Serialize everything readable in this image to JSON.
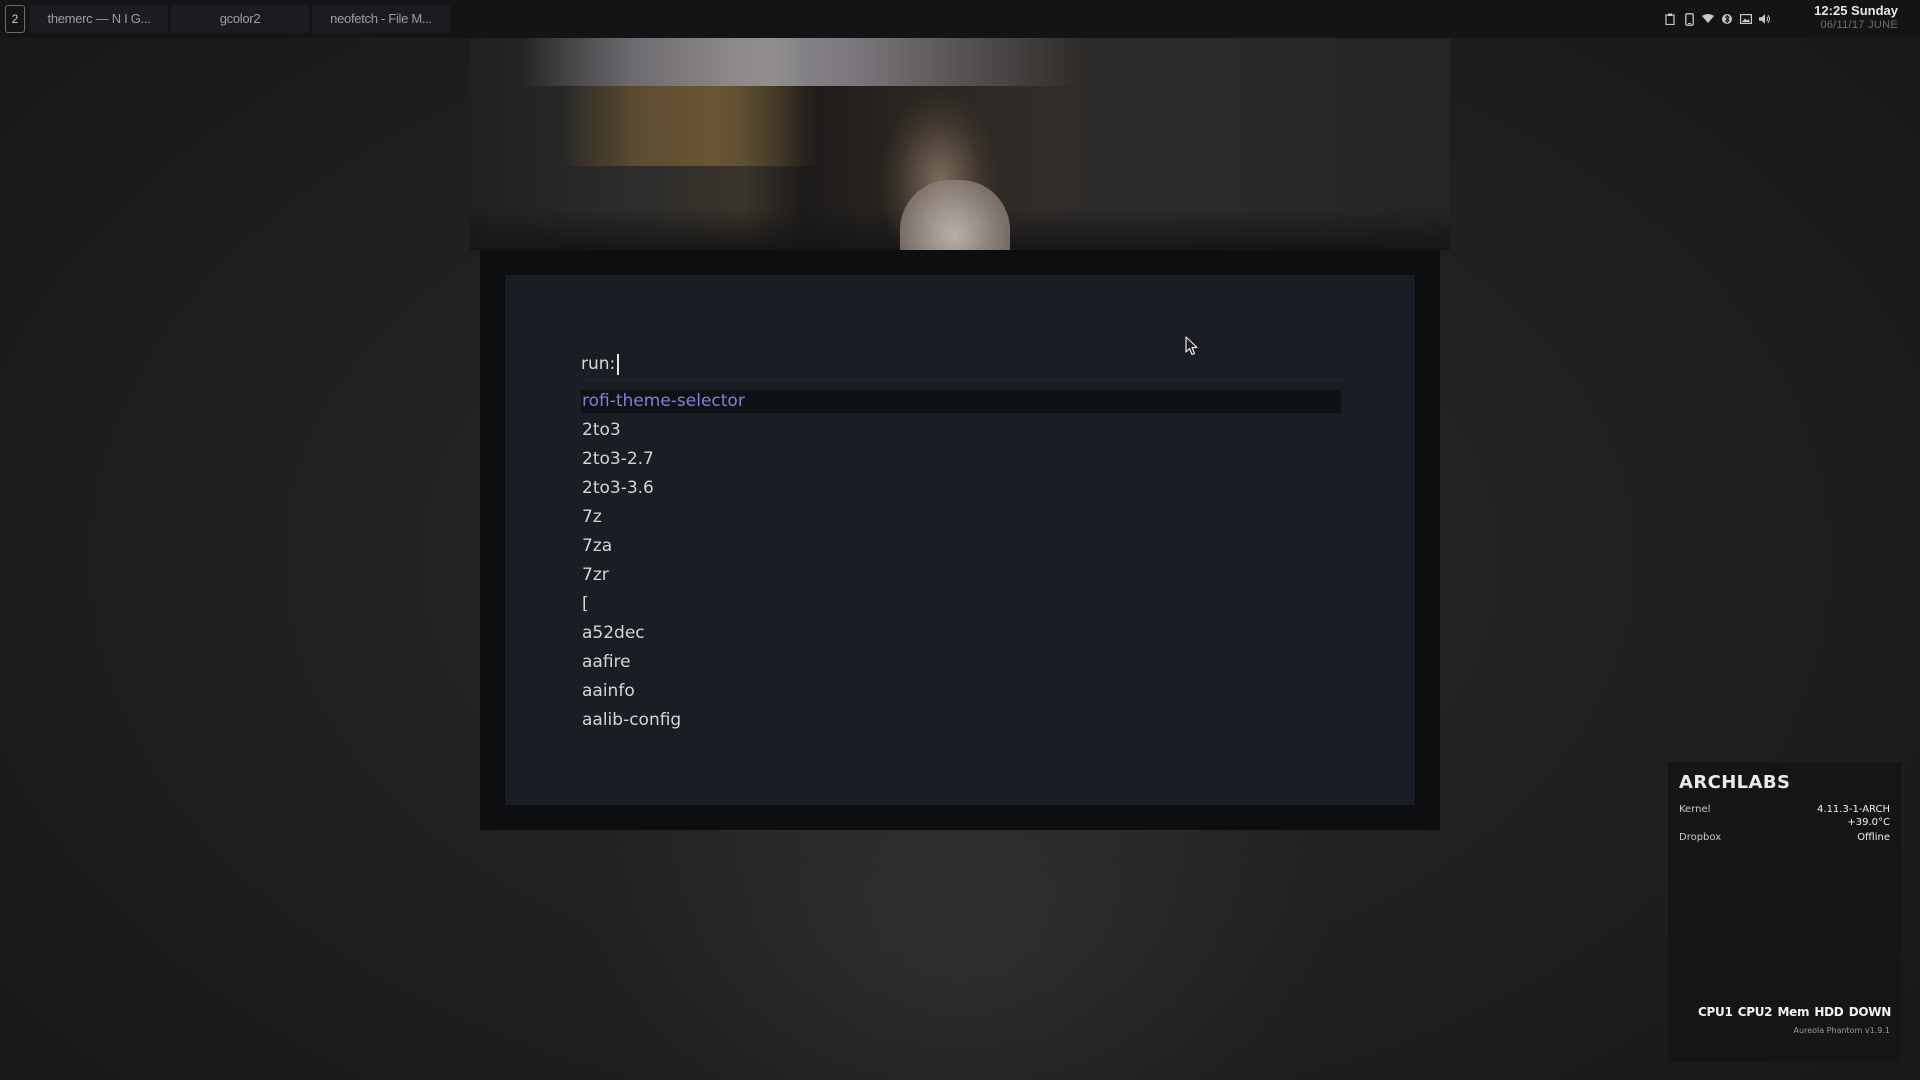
{
  "panel": {
    "workspace": "2",
    "tasks": [
      {
        "label": "themerc — N I G..."
      },
      {
        "label": "gcolor2"
      },
      {
        "label": "neofetch - File M..."
      }
    ],
    "tray_icons": [
      "clipboard-icon",
      "phone-icon",
      "wifi-icon",
      "bluetooth-icon",
      "image-icon",
      "volume-icon"
    ],
    "clock": {
      "time": "12:25 Sunday",
      "date": "06/11/17 JUNE"
    }
  },
  "rofi": {
    "prompt": "run:",
    "input_value": "",
    "results": [
      "rofi-theme-selector",
      "2to3",
      "2to3-2.7",
      "2to3-3.6",
      "7z",
      "7za",
      "7zr",
      "[",
      "a52dec",
      "aafire",
      "aainfo",
      "aalib-config"
    ],
    "selected_index": 0,
    "colors": {
      "selected_text": "#8e7bd8",
      "background": "#1a1e24",
      "border": "#0d0e10"
    }
  },
  "conky": {
    "title": "ARCHLABS",
    "kernel_label": "Kernel",
    "kernel_value": "4.11.3-1-ARCH",
    "temperature": "+39.0°C",
    "dropbox_label": "Dropbox",
    "dropbox_value": "Offline",
    "meters": [
      "CPU1",
      "CPU2",
      "Mem",
      "HDD",
      "DOWN"
    ],
    "footer": "Aureola Phantom v1.9.1"
  }
}
